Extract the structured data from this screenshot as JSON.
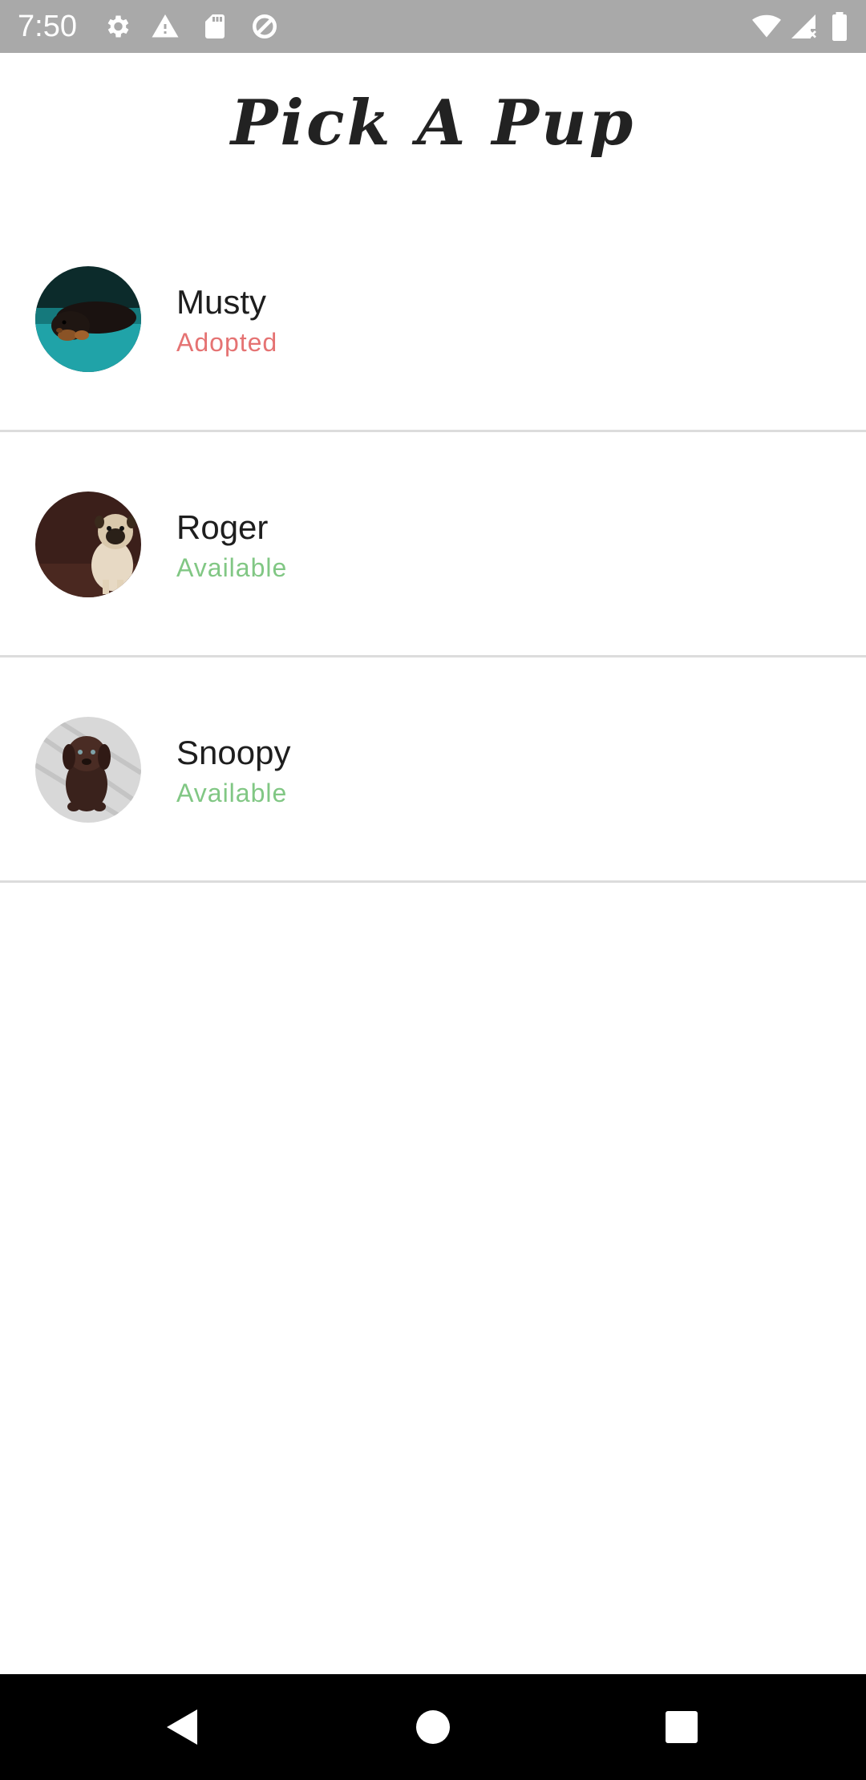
{
  "status_bar": {
    "time": "7:50",
    "icons": [
      "gear-icon",
      "warning-icon",
      "sd-card-icon",
      "data-saver-icon",
      "wifi-icon",
      "cell-signal-icon",
      "battery-icon"
    ]
  },
  "app": {
    "title": "Pick A Pup"
  },
  "pups": [
    {
      "name": "Musty",
      "status": "Adopted",
      "photo": "dachshund-on-teal-photo"
    },
    {
      "name": "Roger",
      "status": "Available",
      "photo": "pug-photo"
    },
    {
      "name": "Snoopy",
      "status": "Available",
      "photo": "chocolate-puppy-photo"
    }
  ],
  "colors": {
    "adopted": "#e57373",
    "available": "#81c784",
    "status_bar": "#a9a9a9",
    "nav_bar": "#000000",
    "divider": "#dcdcdc"
  },
  "nav_bar": {
    "buttons": [
      "back-icon",
      "home-icon",
      "recents-icon"
    ]
  }
}
